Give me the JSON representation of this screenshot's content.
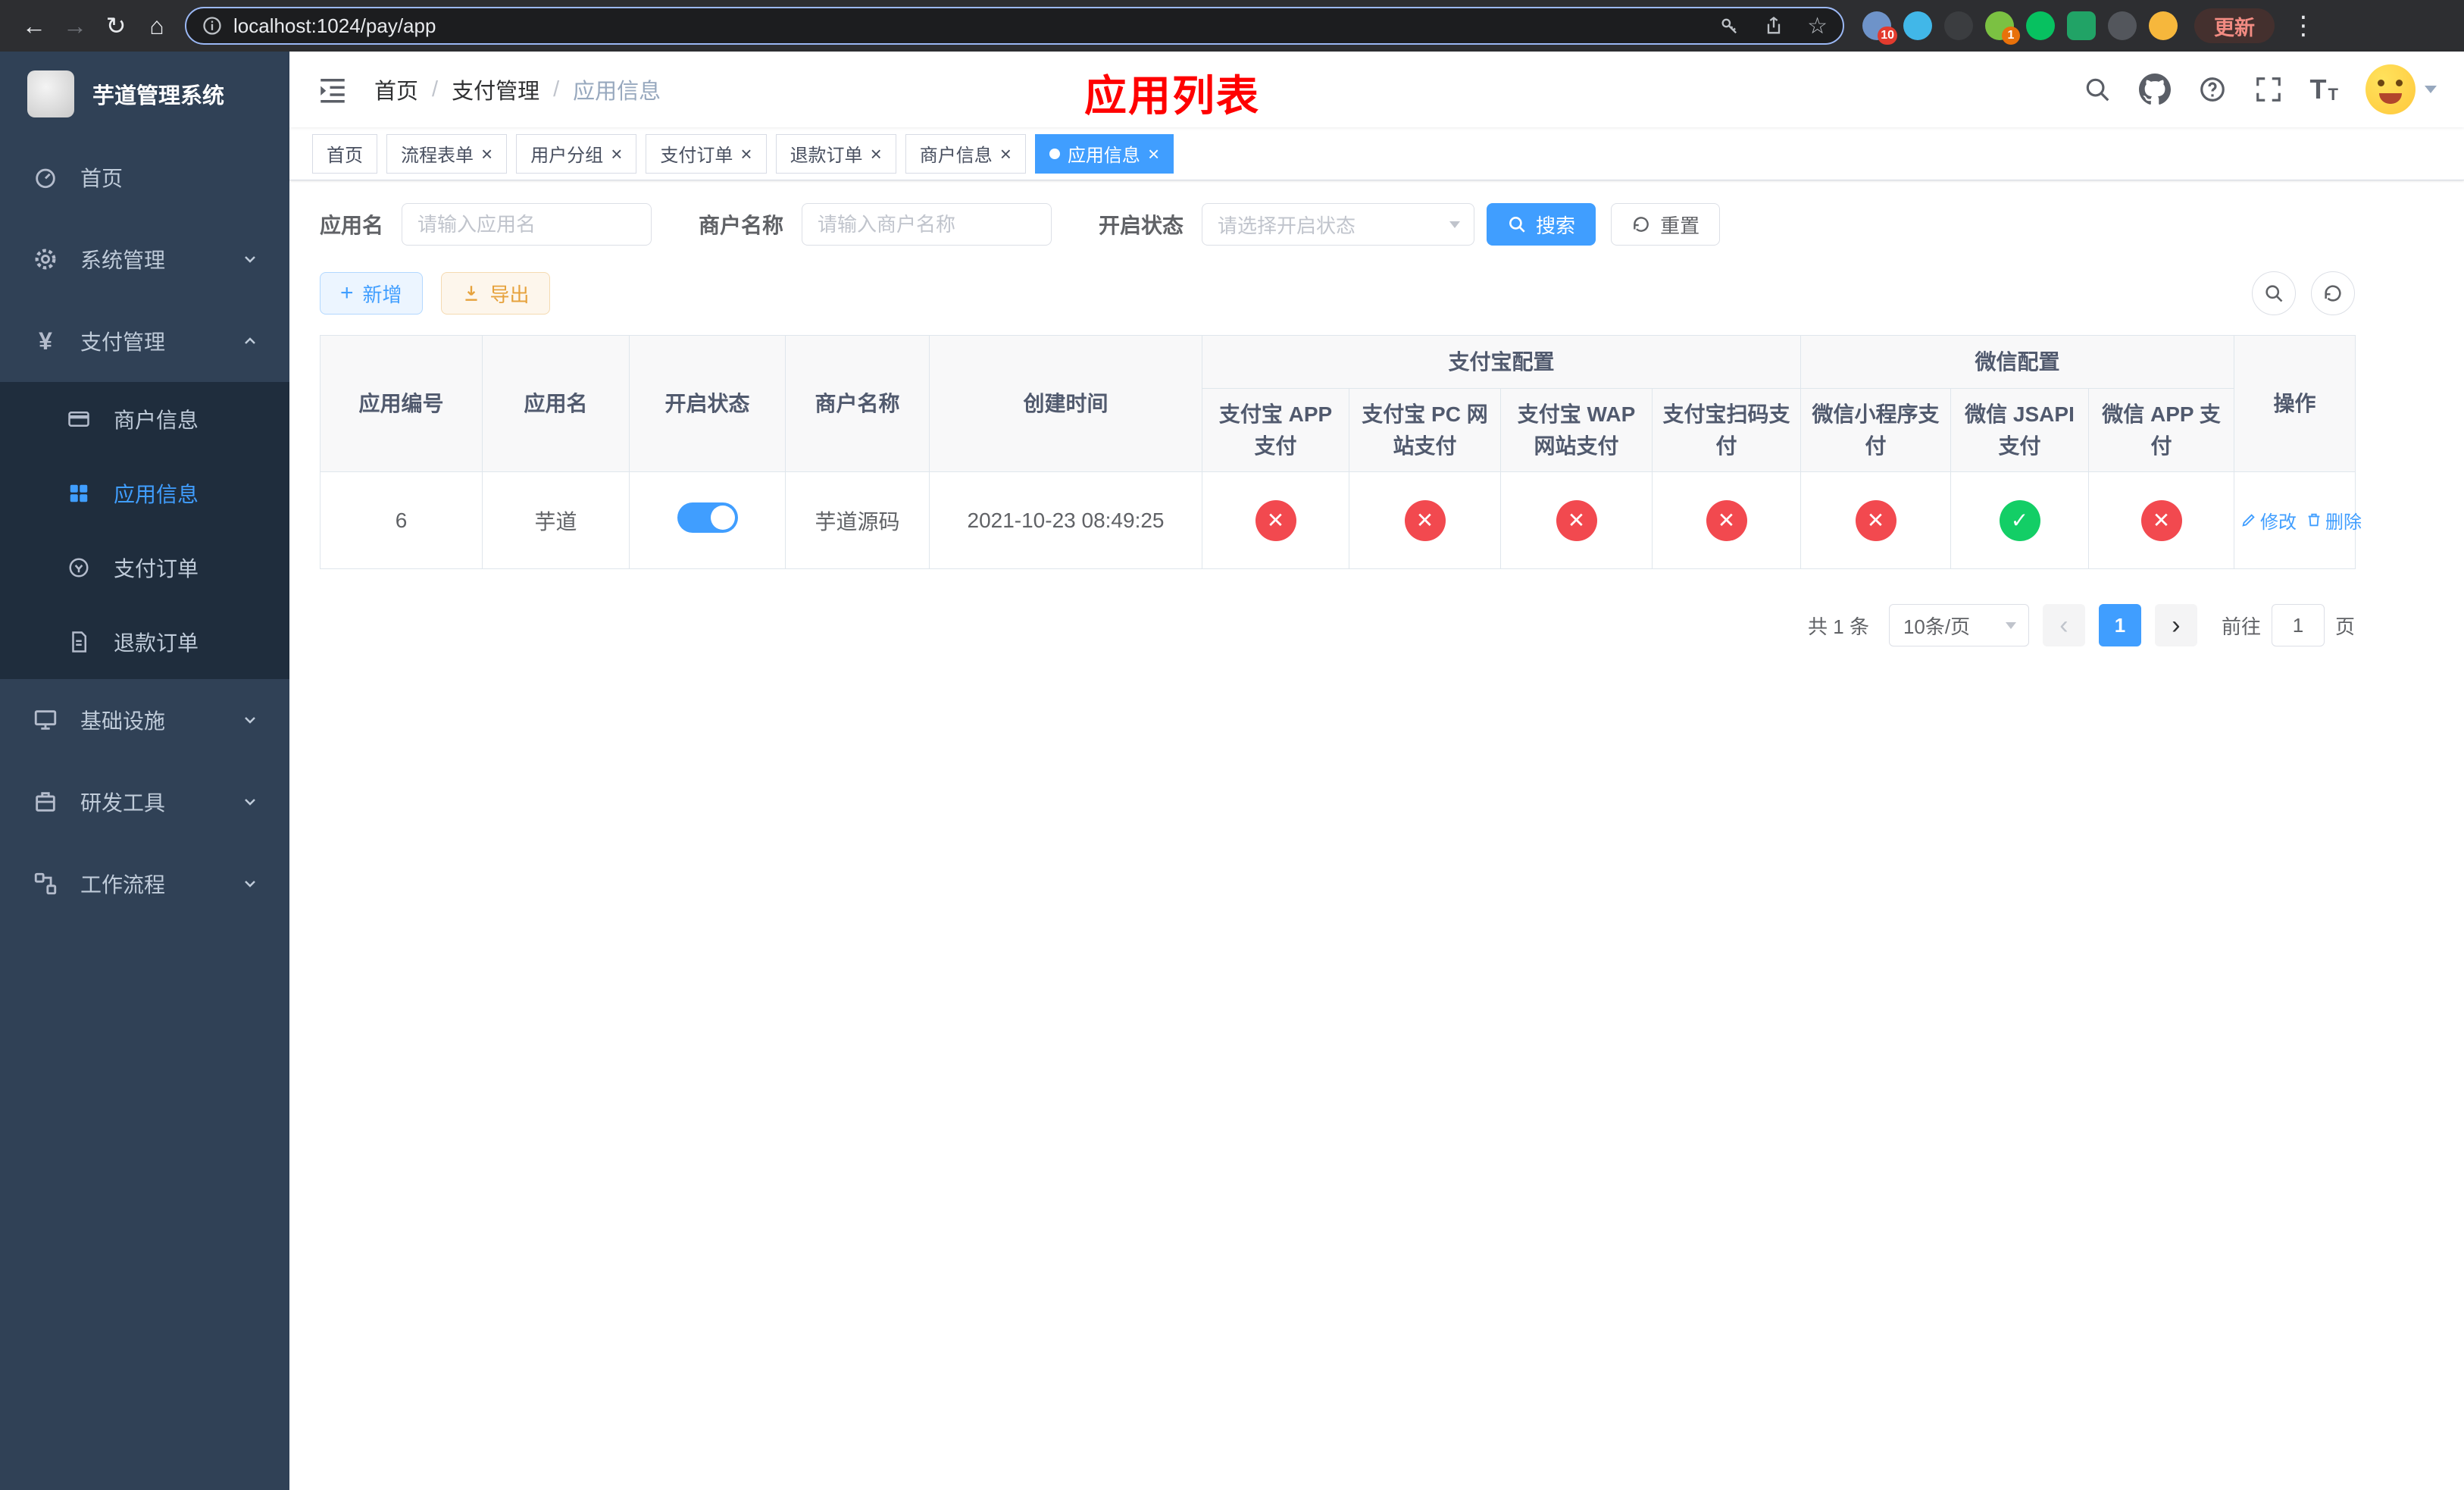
{
  "theme": {
    "accent": "#409eff",
    "danger_circle": "#f2494f",
    "success_circle": "#13ce66",
    "warning": "#e6a23c",
    "sidebar_bg": "#304156",
    "submenu_bg": "#1f2d3d",
    "title_color": "#ff0000"
  },
  "browser": {
    "url": "localhost:1024/pay/app",
    "update_label": "更新",
    "badges": {
      "puzzle": "10",
      "avatar": "1"
    }
  },
  "sidebar": {
    "logo_title": "芋道管理系统",
    "menu": [
      {
        "label": "首页"
      },
      {
        "label": "系统管理"
      },
      {
        "label": "支付管理",
        "expanded": true
      },
      {
        "label": "基础设施"
      },
      {
        "label": "研发工具"
      },
      {
        "label": "工作流程"
      }
    ],
    "submenu": [
      {
        "label": "商户信息"
      },
      {
        "label": "应用信息",
        "state": "active"
      },
      {
        "label": "支付订单"
      },
      {
        "label": "退款订单"
      }
    ]
  },
  "header": {
    "breadcrumb": [
      "首页",
      "支付管理",
      "应用信息"
    ],
    "separator": "/",
    "page_title": "应用列表"
  },
  "tabs": [
    {
      "label": "首页",
      "closable": false
    },
    {
      "label": "流程表单",
      "closable": true
    },
    {
      "label": "用户分组",
      "closable": true
    },
    {
      "label": "支付订单",
      "closable": true
    },
    {
      "label": "退款订单",
      "closable": true
    },
    {
      "label": "商户信息",
      "closable": true
    },
    {
      "label": "应用信息",
      "closable": true,
      "state": "active"
    }
  ],
  "filters": {
    "app_name_label": "应用名",
    "app_name_placeholder": "请输入应用名",
    "merchant_label": "商户名称",
    "merchant_placeholder": "请输入商户名称",
    "status_label": "开启状态",
    "status_placeholder": "请选择开启状态",
    "search_label": "搜索",
    "reset_label": "重置"
  },
  "toolbar": {
    "add_label": "新增",
    "export_label": "导出"
  },
  "table": {
    "headers": {
      "app_id": "应用编号",
      "app_name": "应用名",
      "status": "开启状态",
      "merchant": "商户名称",
      "created": "创建时间",
      "alipay_group": "支付宝配置",
      "wechat_group": "微信配置",
      "alipay_app": "支付宝 APP 支付",
      "alipay_pc": "支付宝 PC 网站支付",
      "alipay_wap": "支付宝 WAP 网站支付",
      "alipay_qr": "支付宝扫码支付",
      "wx_mini": "微信小程序支付",
      "wx_jsapi": "微信 JSAPI 支付",
      "wx_app": "微信 APP 支付",
      "actions": "操作"
    },
    "rows": [
      {
        "app_id": "6",
        "app_name": "芋道",
        "status": "on",
        "merchant": "芋道源码",
        "created": "2021-10-23 08:49:25",
        "configs": [
          "cross",
          "cross",
          "cross",
          "cross",
          "cross",
          "check",
          "cross"
        ],
        "edit_label": "修改",
        "delete_label": "删除"
      }
    ]
  },
  "pagination": {
    "total": "共 1 条",
    "page_size": "10条/页",
    "current_page": "1",
    "goto_label": "前往",
    "goto_value": "1",
    "page_label": "页"
  }
}
